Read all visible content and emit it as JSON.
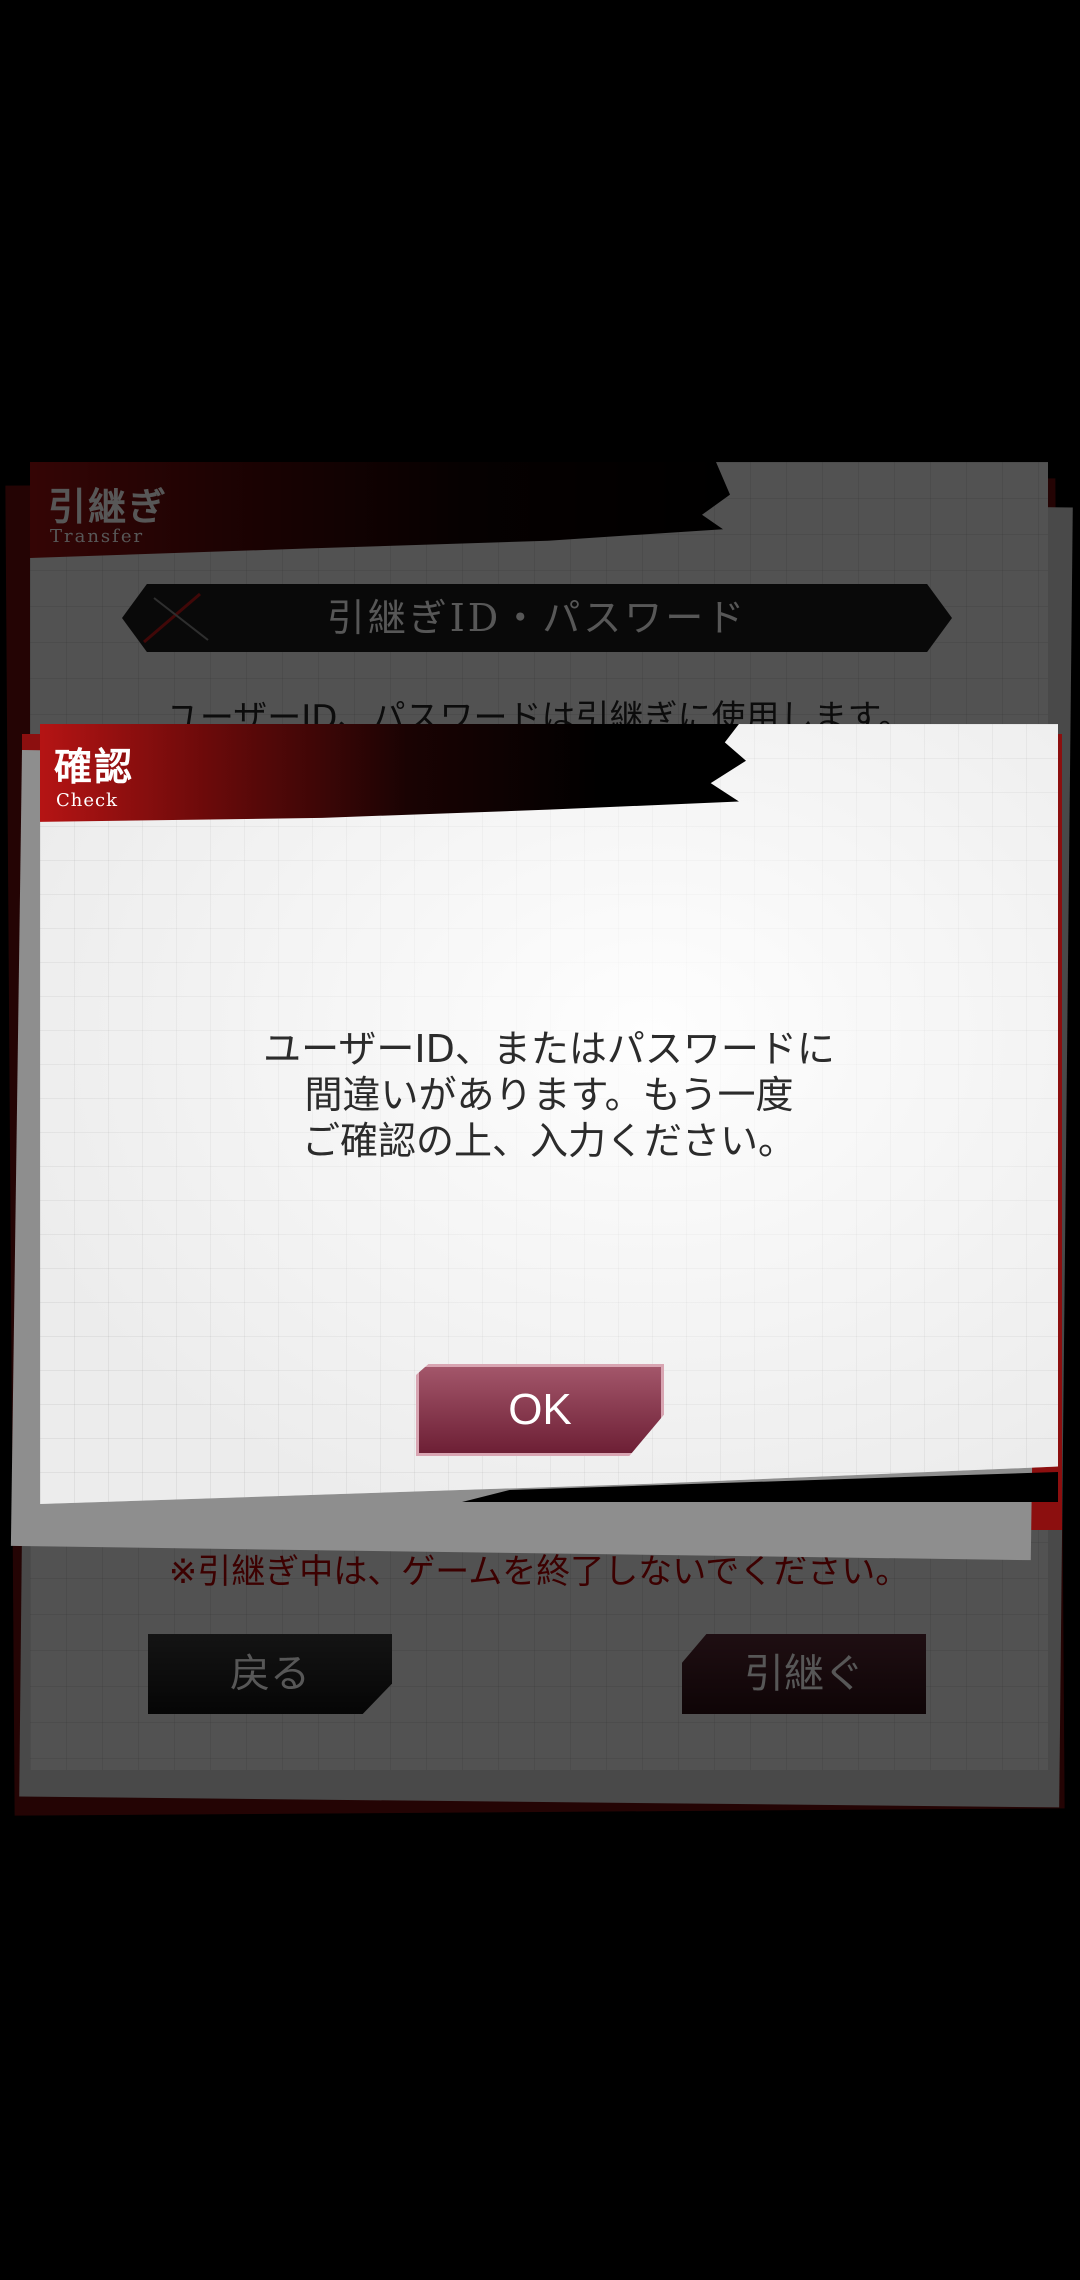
{
  "transfer_dialog": {
    "title": "引継ぎ",
    "subtitle": "Transfer",
    "section_title": "引継ぎID・パスワード",
    "description": "ユーザーID、パスワードは引継ぎに使用します。",
    "warning": "※引継ぎ中は、ゲームを終了しないでください。",
    "back_button": "戻る",
    "transfer_button": "引継ぐ"
  },
  "check_dialog": {
    "title": "確認",
    "subtitle": "Check",
    "message": "ユーザーID、またはパスワードに\n間違いがあります。もう一度\nご確認の上、入力ください。",
    "ok_button": "OK"
  },
  "colors": {
    "header_red": "#b51414",
    "ok_button": "#8a3a4f",
    "warning_text": "#b00000"
  }
}
